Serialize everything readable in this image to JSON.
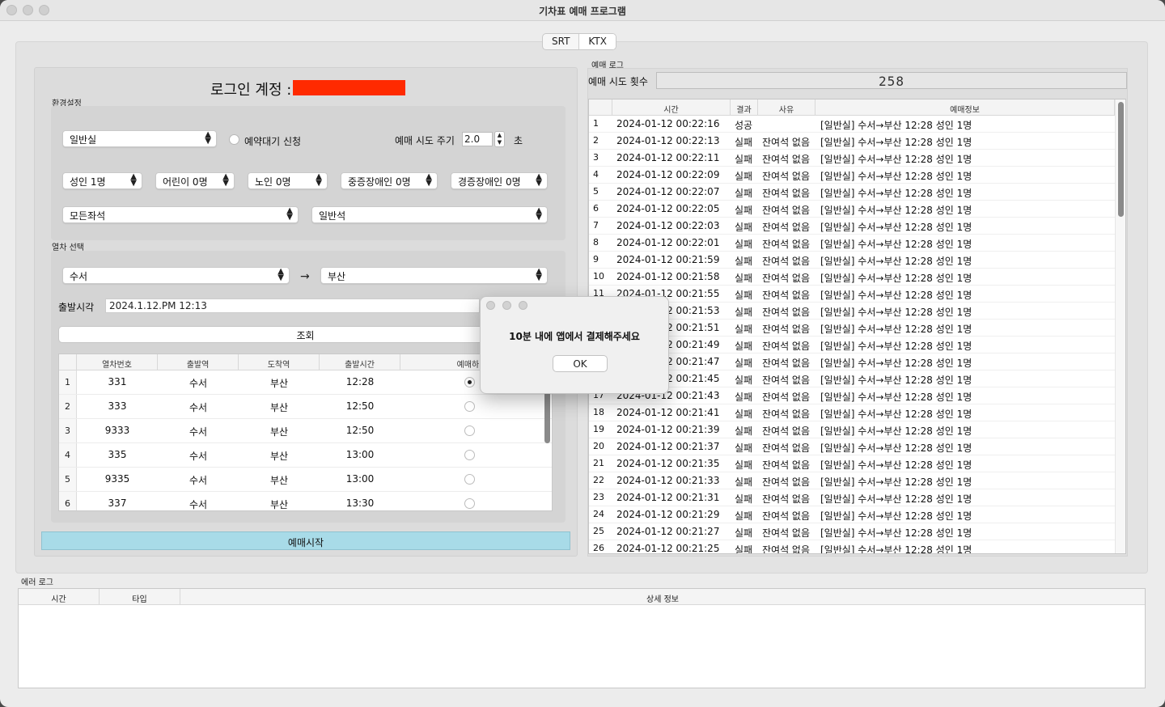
{
  "window": {
    "title": "기차표 예매 프로그램"
  },
  "tabs": [
    {
      "label": "SRT",
      "selected": false
    },
    {
      "label": "KTX",
      "selected": true
    }
  ],
  "login": {
    "label": "로그인 계정 :"
  },
  "settings": {
    "group_label": "환경설정",
    "seat_class": "일반실",
    "waitlist_label": "예약대기 신청",
    "interval_label": "예매 시도 주기",
    "interval_value": "2.0",
    "interval_unit": "초",
    "passengers": [
      "성인 1명",
      "어린이 0명",
      "노인 0명",
      "중증장애인 0명",
      "경증장애인 0명"
    ],
    "seat_type": "모든좌석",
    "car_type": "일반석"
  },
  "train_select": {
    "group_label": "열차 선택",
    "from": "수서",
    "arrow": "→",
    "to": "부산",
    "depart_label": "출발시각",
    "depart_value": "2024.1.12.PM 12:13",
    "search_label": "조회",
    "columns": [
      "열차번호",
      "출발역",
      "도착역",
      "출발시간",
      "예매하기"
    ],
    "rows": [
      {
        "n": "1",
        "train": "331",
        "from": "수서",
        "to": "부산",
        "time": "12:28",
        "selected": true
      },
      {
        "n": "2",
        "train": "333",
        "from": "수서",
        "to": "부산",
        "time": "12:50",
        "selected": false
      },
      {
        "n": "3",
        "train": "9333",
        "from": "수서",
        "to": "부산",
        "time": "12:50",
        "selected": false
      },
      {
        "n": "4",
        "train": "335",
        "from": "수서",
        "to": "부산",
        "time": "13:00",
        "selected": false
      },
      {
        "n": "5",
        "train": "9335",
        "from": "수서",
        "to": "부산",
        "time": "13:00",
        "selected": false
      },
      {
        "n": "6",
        "train": "337",
        "from": "수서",
        "to": "부산",
        "time": "13:30",
        "selected": false
      }
    ],
    "start_label": "예매시작"
  },
  "booking_log": {
    "group_label": "예매 로그",
    "attempts_label": "예매 시도 횟수",
    "attempts_value": "258",
    "columns": [
      "시간",
      "결과",
      "사유",
      "예매정보"
    ],
    "rows": [
      {
        "n": "1",
        "time": "2024-01-12 00:22:16",
        "result": "성공",
        "reason": "",
        "info": "[일반실] 수서→부산 12:28 성인 1명"
      },
      {
        "n": "2",
        "time": "2024-01-12 00:22:13",
        "result": "실패",
        "reason": "잔여석 없음",
        "info": "[일반실] 수서→부산 12:28 성인 1명"
      },
      {
        "n": "3",
        "time": "2024-01-12 00:22:11",
        "result": "실패",
        "reason": "잔여석 없음",
        "info": "[일반실] 수서→부산 12:28 성인 1명"
      },
      {
        "n": "4",
        "time": "2024-01-12 00:22:09",
        "result": "실패",
        "reason": "잔여석 없음",
        "info": "[일반실] 수서→부산 12:28 성인 1명"
      },
      {
        "n": "5",
        "time": "2024-01-12 00:22:07",
        "result": "실패",
        "reason": "잔여석 없음",
        "info": "[일반실] 수서→부산 12:28 성인 1명"
      },
      {
        "n": "6",
        "time": "2024-01-12 00:22:05",
        "result": "실패",
        "reason": "잔여석 없음",
        "info": "[일반실] 수서→부산 12:28 성인 1명"
      },
      {
        "n": "7",
        "time": "2024-01-12 00:22:03",
        "result": "실패",
        "reason": "잔여석 없음",
        "info": "[일반실] 수서→부산 12:28 성인 1명"
      },
      {
        "n": "8",
        "time": "2024-01-12 00:22:01",
        "result": "실패",
        "reason": "잔여석 없음",
        "info": "[일반실] 수서→부산 12:28 성인 1명"
      },
      {
        "n": "9",
        "time": "2024-01-12 00:21:59",
        "result": "실패",
        "reason": "잔여석 없음",
        "info": "[일반실] 수서→부산 12:28 성인 1명"
      },
      {
        "n": "10",
        "time": "2024-01-12 00:21:58",
        "result": "실패",
        "reason": "잔여석 없음",
        "info": "[일반실] 수서→부산 12:28 성인 1명"
      },
      {
        "n": "11",
        "time": "2024-01-12 00:21:55",
        "result": "실패",
        "reason": "잔여석 없음",
        "info": "[일반실] 수서→부산 12:28 성인 1명"
      },
      {
        "n": "12",
        "time": "2024-01-12 00:21:53",
        "result": "실패",
        "reason": "잔여석 없음",
        "info": "[일반실] 수서→부산 12:28 성인 1명"
      },
      {
        "n": "13",
        "time": "2024-01-12 00:21:51",
        "result": "실패",
        "reason": "잔여석 없음",
        "info": "[일반실] 수서→부산 12:28 성인 1명"
      },
      {
        "n": "14",
        "time": "2024-01-12 00:21:49",
        "result": "실패",
        "reason": "잔여석 없음",
        "info": "[일반실] 수서→부산 12:28 성인 1명"
      },
      {
        "n": "15",
        "time": "2024-01-12 00:21:47",
        "result": "실패",
        "reason": "잔여석 없음",
        "info": "[일반실] 수서→부산 12:28 성인 1명"
      },
      {
        "n": "16",
        "time": "2024-01-12 00:21:45",
        "result": "실패",
        "reason": "잔여석 없음",
        "info": "[일반실] 수서→부산 12:28 성인 1명"
      },
      {
        "n": "17",
        "time": "2024-01-12 00:21:43",
        "result": "실패",
        "reason": "잔여석 없음",
        "info": "[일반실] 수서→부산 12:28 성인 1명"
      },
      {
        "n": "18",
        "time": "2024-01-12 00:21:41",
        "result": "실패",
        "reason": "잔여석 없음",
        "info": "[일반실] 수서→부산 12:28 성인 1명"
      },
      {
        "n": "19",
        "time": "2024-01-12 00:21:39",
        "result": "실패",
        "reason": "잔여석 없음",
        "info": "[일반실] 수서→부산 12:28 성인 1명"
      },
      {
        "n": "20",
        "time": "2024-01-12 00:21:37",
        "result": "실패",
        "reason": "잔여석 없음",
        "info": "[일반실] 수서→부산 12:28 성인 1명"
      },
      {
        "n": "21",
        "time": "2024-01-12 00:21:35",
        "result": "실패",
        "reason": "잔여석 없음",
        "info": "[일반실] 수서→부산 12:28 성인 1명"
      },
      {
        "n": "22",
        "time": "2024-01-12 00:21:33",
        "result": "실패",
        "reason": "잔여석 없음",
        "info": "[일반실] 수서→부산 12:28 성인 1명"
      },
      {
        "n": "23",
        "time": "2024-01-12 00:21:31",
        "result": "실패",
        "reason": "잔여석 없음",
        "info": "[일반실] 수서→부산 12:28 성인 1명"
      },
      {
        "n": "24",
        "time": "2024-01-12 00:21:29",
        "result": "실패",
        "reason": "잔여석 없음",
        "info": "[일반실] 수서→부산 12:28 성인 1명"
      },
      {
        "n": "25",
        "time": "2024-01-12 00:21:27",
        "result": "실패",
        "reason": "잔여석 없음",
        "info": "[일반실] 수서→부산 12:28 성인 1명"
      },
      {
        "n": "26",
        "time": "2024-01-12 00:21:25",
        "result": "실패",
        "reason": "잔여석 없음",
        "info": "[일반실] 수서→부산 12:28 성인 1명"
      }
    ]
  },
  "error_log": {
    "group_label": "에러 로그",
    "columns": [
      "시간",
      "타입",
      "상세 정보"
    ]
  },
  "dialog": {
    "message": "10분 내에 앱에서 결제해주세요",
    "ok_label": "OK"
  }
}
